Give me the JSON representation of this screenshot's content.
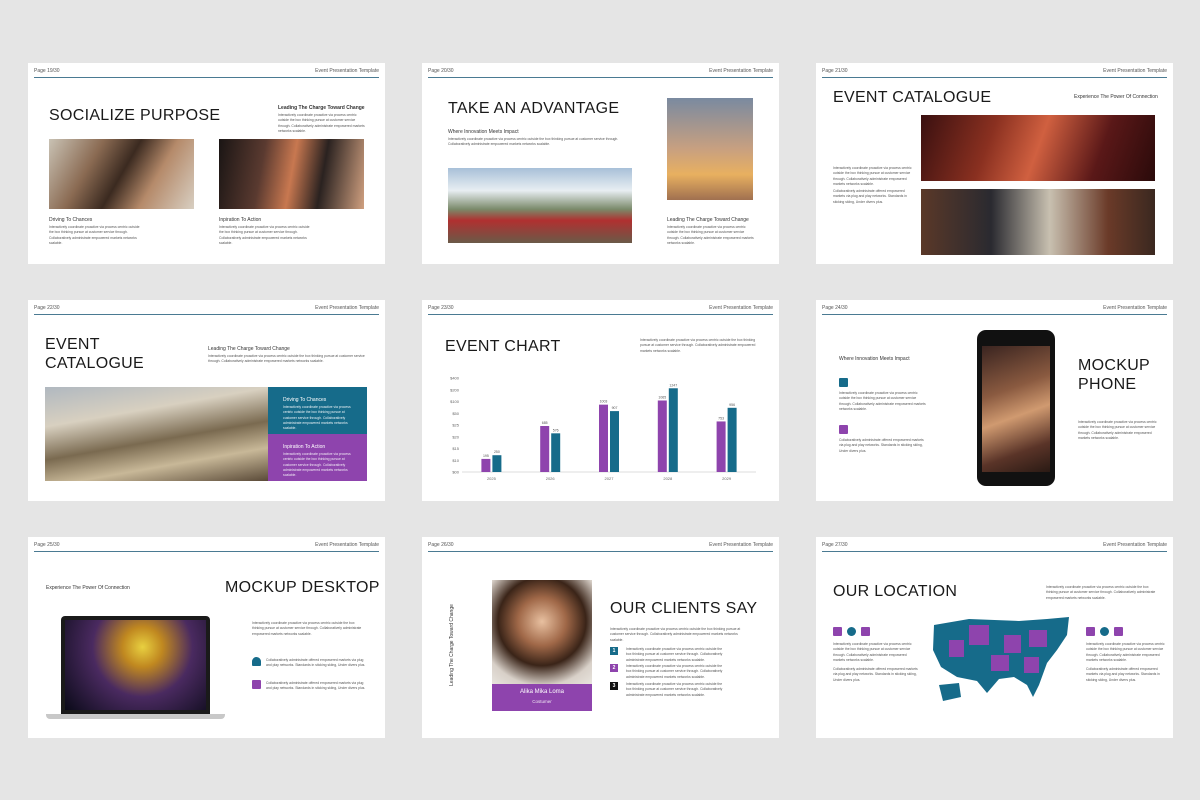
{
  "template_name": "Event Presentation Template",
  "lorem": "Interactively coordinate proactive via process centric outside the box thinking pursue at customer service through. Collaboratively administrate empowered markets networks scalable.",
  "lorem2": "Collaboratively administrate offered empowered markets via plug and play networks. Standards in sticking skiing, Under divers plus.",
  "slides": {
    "s1": {
      "page": "Page 19/30",
      "title": "SOCIALIZE PURPOSE",
      "sub": "Leading The Charge Toward Change",
      "cap1": "Driving To Chances",
      "cap2": "Inpiration To Action"
    },
    "s2": {
      "page": "Page 20/30",
      "title": "TAKE AN ADVANTAGE",
      "sub": "Where Innovation Meets Impact",
      "sub2": "Leading The Charge Toward Change"
    },
    "s3": {
      "page": "Page 21/30",
      "title": "EVENT CATALOGUE",
      "sub": "Experience The Power Of Connection"
    },
    "s4": {
      "page": "Page 22/30",
      "title1": "EVENT",
      "title2": "CATALOGUE",
      "sub": "Leading The Charge Toward Change",
      "box1": "Driving To Chances",
      "box2": "Inpiration To Action"
    },
    "s5": {
      "page": "Page 23/30",
      "title": "EVENT CHART"
    },
    "s6": {
      "page": "Page 24/30",
      "title1": "MOCKUP",
      "title2": "PHONE",
      "sub": "Where Innovation Meets Impact"
    },
    "s7": {
      "page": "Page 25/30",
      "title": "MOCKUP DESKTOP",
      "sub": "Experience The Power Of Connection"
    },
    "s8": {
      "page": "Page 26/30",
      "title": "OUR CLIENTS SAY",
      "vertical": "Leading The Charge Toward Change",
      "name": "Alika Mika Loma",
      "role": "Costumer",
      "n1": "1",
      "n2": "2",
      "n3": "3"
    },
    "s9": {
      "page": "Page 27/30",
      "title": "OUR LOCATION"
    }
  },
  "chart_data": {
    "type": "bar",
    "categories": [
      "2025",
      "2026",
      "2027",
      "2028",
      "2029"
    ],
    "series": [
      {
        "color": "#8e44ad",
        "values": [
          195,
          685,
          1003,
          1065,
          753
        ]
      },
      {
        "color": "#166b8a",
        "values": [
          250,
          576,
          907,
          1247,
          956
        ]
      }
    ],
    "ylim": [
      0,
      1400
    ],
    "yticks": [
      "$400",
      "$200",
      "$100",
      "$50",
      "$25",
      "$20",
      "$15",
      "$10",
      "$00"
    ],
    "value_labels": [
      [
        "195",
        "685",
        "1003",
        "1065",
        "753"
      ],
      [
        "250",
        "576",
        "907",
        "1247",
        "956"
      ]
    ]
  },
  "colors": {
    "accent_purple": "#8e44ad",
    "accent_teal": "#166b8a"
  }
}
